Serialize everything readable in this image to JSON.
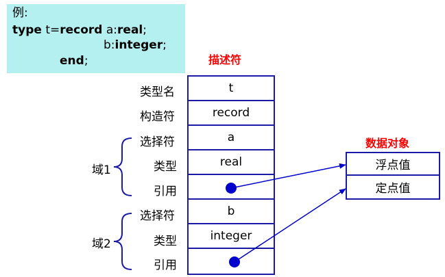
{
  "example": {
    "label": "例:",
    "line1_kw1": "type",
    "line1_t": " t=",
    "line1_kw2": "record",
    "line1_field": " a:",
    "line1_kw3": "real",
    "line1_end": ";",
    "line2_field": "b:",
    "line2_kw": "integer",
    "line2_end": ";",
    "line3_kw": "end",
    "line3_end": ";"
  },
  "descriptor": {
    "title": "描述符",
    "rows": [
      {
        "label": "类型名",
        "value": "t"
      },
      {
        "label": "构造符",
        "value": "record"
      },
      {
        "label": "选择符",
        "value": "a"
      },
      {
        "label": "类型",
        "value": "real"
      },
      {
        "label": "引用",
        "value": ""
      },
      {
        "label": "选择符",
        "value": "b"
      },
      {
        "label": "类型",
        "value": "integer"
      },
      {
        "label": "引用",
        "value": ""
      }
    ],
    "domains": [
      "域1",
      "域2"
    ]
  },
  "data_objects": {
    "title": "数据对象",
    "items": [
      "浮点值",
      "定点值"
    ]
  },
  "colors": {
    "code_bg": "#b3f0ef",
    "border": "#1a1aa6",
    "title_red": "#ff0000",
    "pointer": "#0000cc"
  }
}
